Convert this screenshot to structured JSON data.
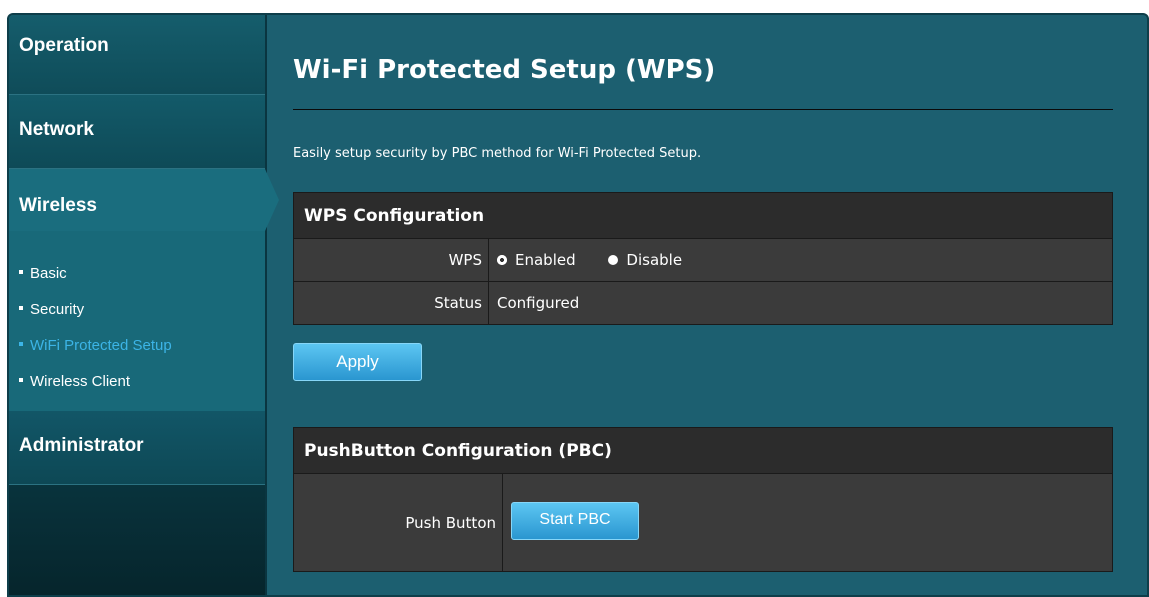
{
  "sidebar": {
    "operation": "Operation",
    "network": "Network",
    "wireless": "Wireless",
    "wireless_items": [
      {
        "label": "Basic"
      },
      {
        "label": "Security"
      },
      {
        "label": "WiFi Protected Setup"
      },
      {
        "label": "Wireless Client"
      }
    ],
    "active_item": "WiFi Protected Setup",
    "administrator": "Administrator"
  },
  "page": {
    "title": "Wi-Fi Protected Setup (WPS)",
    "description": "Easily setup security by PBC method for Wi-Fi Protected Setup."
  },
  "wps_config": {
    "header": "WPS Configuration",
    "wps_label": "WPS",
    "option_enabled": "Enabled",
    "option_disable": "Disable",
    "selected": "Enabled",
    "status_label": "Status",
    "status_value": "Configured",
    "apply_label": "Apply"
  },
  "pbc_config": {
    "header": "PushButton Configuration (PBC)",
    "push_button_label": "Push Button",
    "start_label": "Start PBC"
  },
  "colors": {
    "background": "#1c5f70",
    "active_link": "#3cb4e6",
    "button": "#3aa8dc",
    "panel_header": "#2c2c2c",
    "panel_body": "#3b3b3b"
  }
}
